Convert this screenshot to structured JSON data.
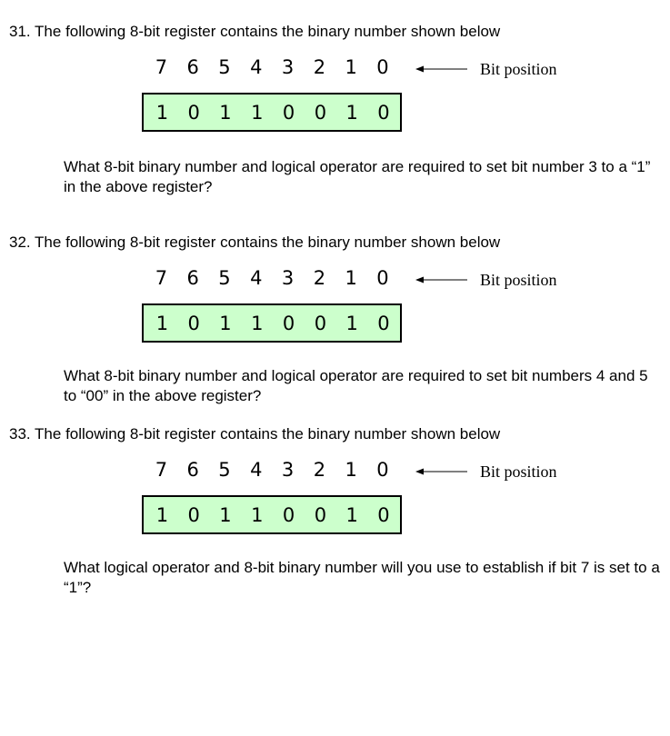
{
  "bit_position_label": "Bit position",
  "questions": [
    {
      "heading": "31. The following 8-bit register contains the binary number shown below",
      "positions": [
        "7",
        "6",
        "5",
        "4",
        "3",
        "2",
        "1",
        "0"
      ],
      "bits": [
        "1",
        "0",
        "1",
        "1",
        "0",
        "0",
        "1",
        "0"
      ],
      "question": "What 8-bit binary number and logical operator are required to set bit number 3 to a “1” in the above register?"
    },
    {
      "heading": "32. The following 8-bit register contains the binary number shown below",
      "positions": [
        "7",
        "6",
        "5",
        "4",
        "3",
        "2",
        "1",
        "0"
      ],
      "bits": [
        "1",
        "0",
        "1",
        "1",
        "0",
        "0",
        "1",
        "0"
      ],
      "question": "What 8-bit binary number and logical operator are required to set bit numbers 4 and 5 to “00” in the above register?"
    },
    {
      "heading": "33. The following 8-bit register contains the binary number shown below",
      "positions": [
        "7",
        "6",
        "5",
        "4",
        "3",
        "2",
        "1",
        "0"
      ],
      "bits": [
        "1",
        "0",
        "1",
        "1",
        "0",
        "0",
        "1",
        "0"
      ],
      "question": "What logical operator and 8-bit binary number will you use to establish if bit 7 is set to a “1”?"
    }
  ]
}
